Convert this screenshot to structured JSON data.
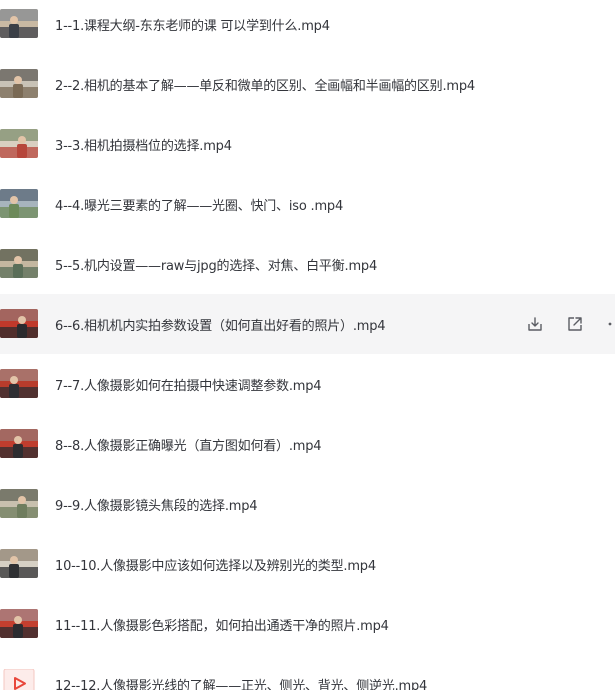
{
  "files": [
    {
      "name": "1--1.课程大纲-东东老师的课 可以学到什么.mp4",
      "thumb": "video"
    },
    {
      "name": "2--2.相机的基本了解——单反和微单的区别、全画幅和半画幅的区别.mp4",
      "thumb": "video"
    },
    {
      "name": "3--3.相机拍摄档位的选择.mp4",
      "thumb": "video"
    },
    {
      "name": "4--4.曝光三要素的了解——光圈、快门、iso .mp4",
      "thumb": "video"
    },
    {
      "name": "5--5.机内设置——raw与jpg的选择、对焦、白平衡.mp4",
      "thumb": "video"
    },
    {
      "name": "6--6.相机机内实拍参数设置（如何直出好看的照片）.mp4",
      "thumb": "video"
    },
    {
      "name": "7--7.人像摄影如何在拍摄中快速调整参数.mp4",
      "thumb": "video"
    },
    {
      "name": "8--8.人像摄影正确曝光（直方图如何看）.mp4",
      "thumb": "video"
    },
    {
      "name": "9--9.人像摄影镜头焦段的选择.mp4",
      "thumb": "video"
    },
    {
      "name": "10--10.人像摄影中应该如何选择以及辨别光的类型.mp4",
      "thumb": "video"
    },
    {
      "name": "11--11.人像摄影色彩搭配，如何拍出通透干净的照片.mp4",
      "thumb": "video"
    },
    {
      "name": "12--12.人像摄影光线的了解——正光、侧光、背光、侧逆光.mp4",
      "thumb": "video-placeholder"
    }
  ],
  "hovered_row": 6,
  "row_actions": {
    "download": "download-icon",
    "open": "open-external-icon",
    "more": "more-icon"
  },
  "colors": {
    "hover_background": "#f5f5f6",
    "text": "#33353b",
    "icon": "#5b5d63",
    "placeholder_play": "#e8473b"
  }
}
